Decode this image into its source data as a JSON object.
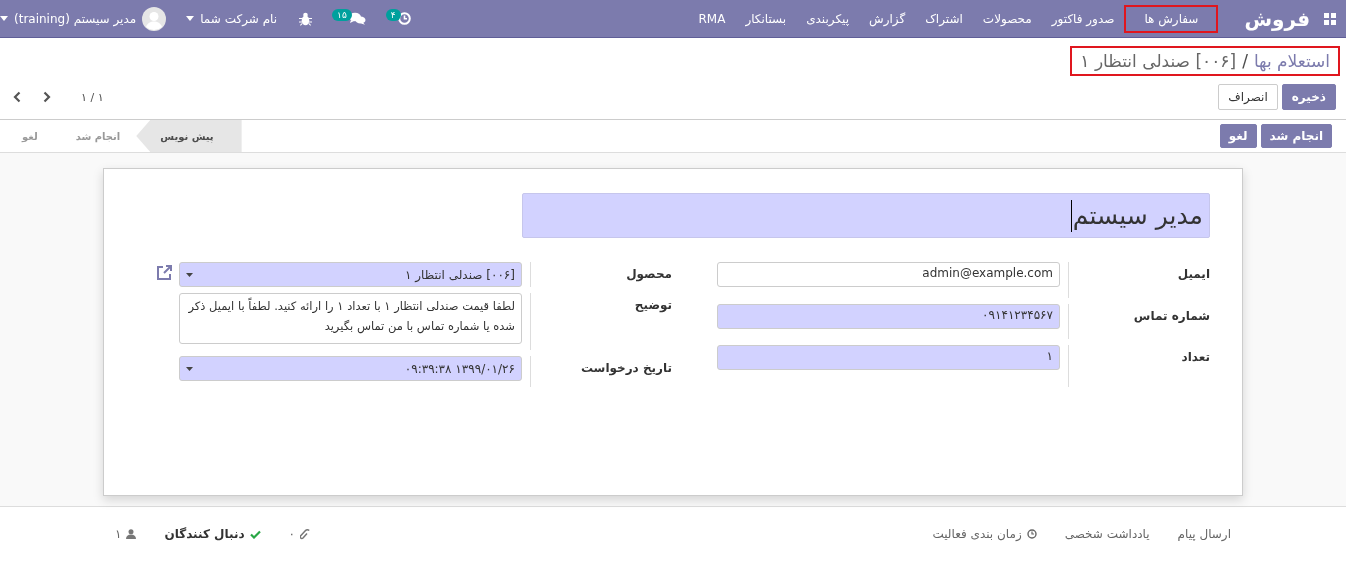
{
  "navbar": {
    "brand": "فروش",
    "menu": [
      {
        "label": "سفارش ها",
        "highlighted": true
      },
      {
        "label": "صدور فاکتور",
        "highlighted": false
      },
      {
        "label": "محصولات",
        "highlighted": false
      },
      {
        "label": "اشتراک",
        "highlighted": false
      },
      {
        "label": "گزارش",
        "highlighted": false
      },
      {
        "label": "پیکربندی",
        "highlighted": false
      },
      {
        "label": "بستانکار",
        "highlighted": false
      },
      {
        "label": "RMA",
        "highlighted": false
      }
    ],
    "systray": {
      "activity_count": "۴",
      "message_count": "۱۵",
      "company": "نام شرکت شما",
      "user": "مدیر سیستم (training)"
    }
  },
  "breadcrumb": {
    "highlighted": true,
    "separator": "/",
    "items": [
      {
        "label": "استعلام بها"
      },
      {
        "label": "[۰۰۶] صندلی انتظار ۱"
      }
    ]
  },
  "buttons": [
    {
      "label": "ذخیره",
      "kind": "primary"
    },
    {
      "label": "انصراف",
      "kind": "secondary"
    }
  ],
  "pager": "۱ / ۱",
  "header_buttons": [
    "انجام شد",
    "لغو"
  ],
  "stages": [
    {
      "label": "پیش نویس",
      "selected": true
    },
    {
      "label": "انجام شد",
      "selected": false
    },
    {
      "label": "لغو",
      "selected": false
    }
  ],
  "form": {
    "title": "مدیر سیستم",
    "groups": [
      {
        "fields": [
          {
            "label": "ایمیل",
            "value": "admin@example.com",
            "kind": "text",
            "required": false
          },
          {
            "label": "شماره تماس",
            "value": "۰۹۱۴۱۲۳۴۵۶۷",
            "kind": "text",
            "required": true
          },
          {
            "label": "تعداد",
            "value": "۱",
            "kind": "text",
            "required": true
          }
        ]
      },
      {
        "fields": [
          {
            "label": "محصول",
            "value": "[۰۰۶] صندلی انتظار ۱",
            "kind": "select",
            "required": true,
            "external_link": true
          },
          {
            "label": "توضیح",
            "value": "لطفا قیمت صندلی انتظار ۱ با تعداد ۱ را ارائه کنید. لطفاً با ایمیل ذکر شده یا شماره تماس با من تماس بگیرید",
            "kind": "textarea",
            "required": false
          },
          {
            "label": "تاریخ درخواست",
            "value": "۱۳۹۹/۰۱/۲۶ ۰۹:۳۹:۳۸",
            "kind": "select",
            "required": true
          }
        ]
      }
    ]
  },
  "chatter": {
    "actions": [
      {
        "label": "ارسال پیام",
        "kind": "plain"
      },
      {
        "label": "یادداشت شخصی",
        "kind": "plain"
      },
      {
        "label": "زمان بندی فعالیت",
        "kind": "activity"
      }
    ],
    "attachments": "۰",
    "follow": "دنبال کنندگان",
    "followers": "۱"
  }
}
